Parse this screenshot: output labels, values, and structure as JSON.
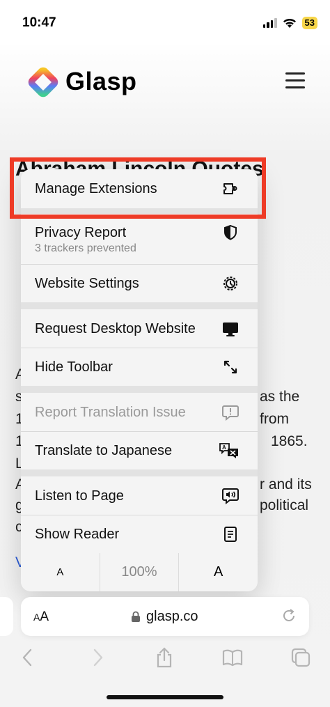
{
  "status": {
    "time": "10:47",
    "battery": "53"
  },
  "site": {
    "brand": "Glasp",
    "heading": "Abraham Lincoln Quotes",
    "body_fragments": [
      {
        "text": "A"
      },
      {
        "text": "s"
      },
      {
        "text": "as the"
      },
      {
        "text": "1"
      },
      {
        "text": "from"
      },
      {
        "text": "1"
      },
      {
        "text": "1865."
      },
      {
        "text": "L"
      },
      {
        "text": "A"
      },
      {
        "text": "r and its"
      },
      {
        "text": "g"
      },
      {
        "text": "political"
      },
      {
        "text": "c"
      },
      {
        "text": "V"
      }
    ]
  },
  "menu": {
    "manage_extensions": "Manage Extensions",
    "privacy_report": "Privacy Report",
    "privacy_sub": "3 trackers prevented",
    "website_settings": "Website Settings",
    "request_desktop": "Request Desktop Website",
    "hide_toolbar": "Hide Toolbar",
    "report_translation": "Report Translation Issue",
    "translate": "Translate to Japanese",
    "listen": "Listen to Page",
    "show_reader": "Show Reader",
    "zoom_small": "A",
    "zoom_level": "100%",
    "zoom_large": "A"
  },
  "toolbar": {
    "aa_big": "A",
    "aa_small": "A",
    "url": "glasp.co"
  },
  "colors": {
    "highlight": "#ee3b26",
    "battery": "#f7d64a",
    "link": "#2a5bd7"
  },
  "icons": [
    "signal-icon",
    "wifi-icon",
    "battery-icon",
    "glasp-logo",
    "menu-icon",
    "extension-icon",
    "shield-icon",
    "gear-icon",
    "desktop-icon",
    "resize-arrows-icon",
    "report-bubble-icon",
    "translate-icon",
    "speaker-bubble-icon",
    "reader-icon",
    "lock-icon",
    "reload-icon",
    "back-icon",
    "forward-icon",
    "share-icon",
    "bookmarks-icon",
    "tabs-icon"
  ]
}
